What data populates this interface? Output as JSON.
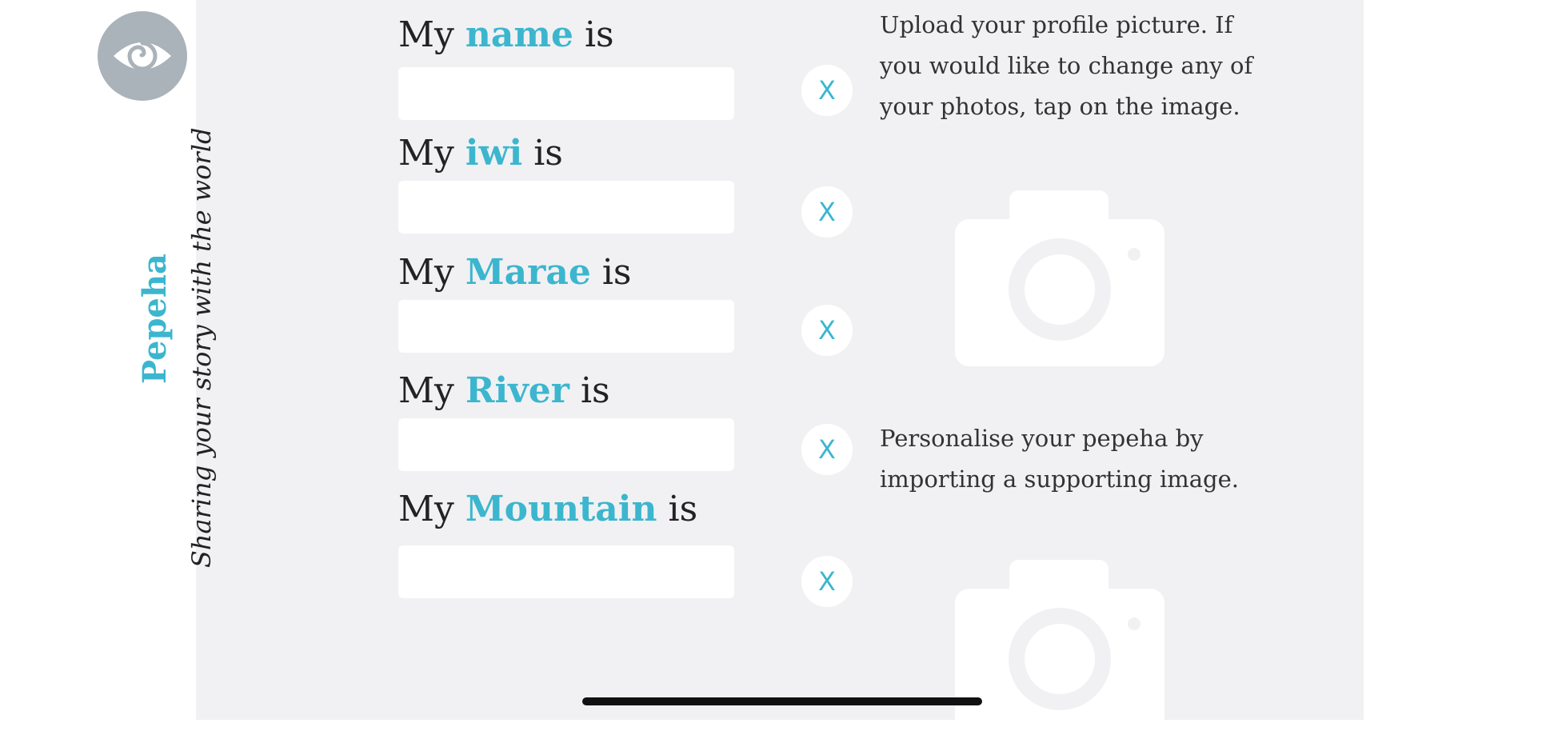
{
  "app": {
    "title": "Pepeha",
    "tagline": "Sharing your story with the world",
    "icon": "spiral-eye-icon"
  },
  "fields": [
    {
      "prefix": "My",
      "keyword": "name",
      "suffix": "is",
      "value": "",
      "placeholder": ""
    },
    {
      "prefix": "My",
      "keyword": "iwi",
      "suffix": "is",
      "value": "",
      "placeholder": ""
    },
    {
      "prefix": "My",
      "keyword": "Marae",
      "suffix": "is",
      "value": "",
      "placeholder": ""
    },
    {
      "prefix": "My",
      "keyword": "River",
      "suffix": "is",
      "value": "",
      "placeholder": ""
    },
    {
      "prefix": "My",
      "keyword": "Mountain",
      "suffix": "is",
      "value": "",
      "placeholder": ""
    }
  ],
  "clear_button": {
    "glyph": "X"
  },
  "profile_help": "Upload your profile picture. If you would like to change any of your photos, tap on the image.",
  "support_help": "Personalise your pepeha by importing a supporting image.",
  "colors": {
    "accent": "#3cb6ce",
    "panel": "#f1f1f3",
    "icon_bg": "#aab2ba"
  }
}
